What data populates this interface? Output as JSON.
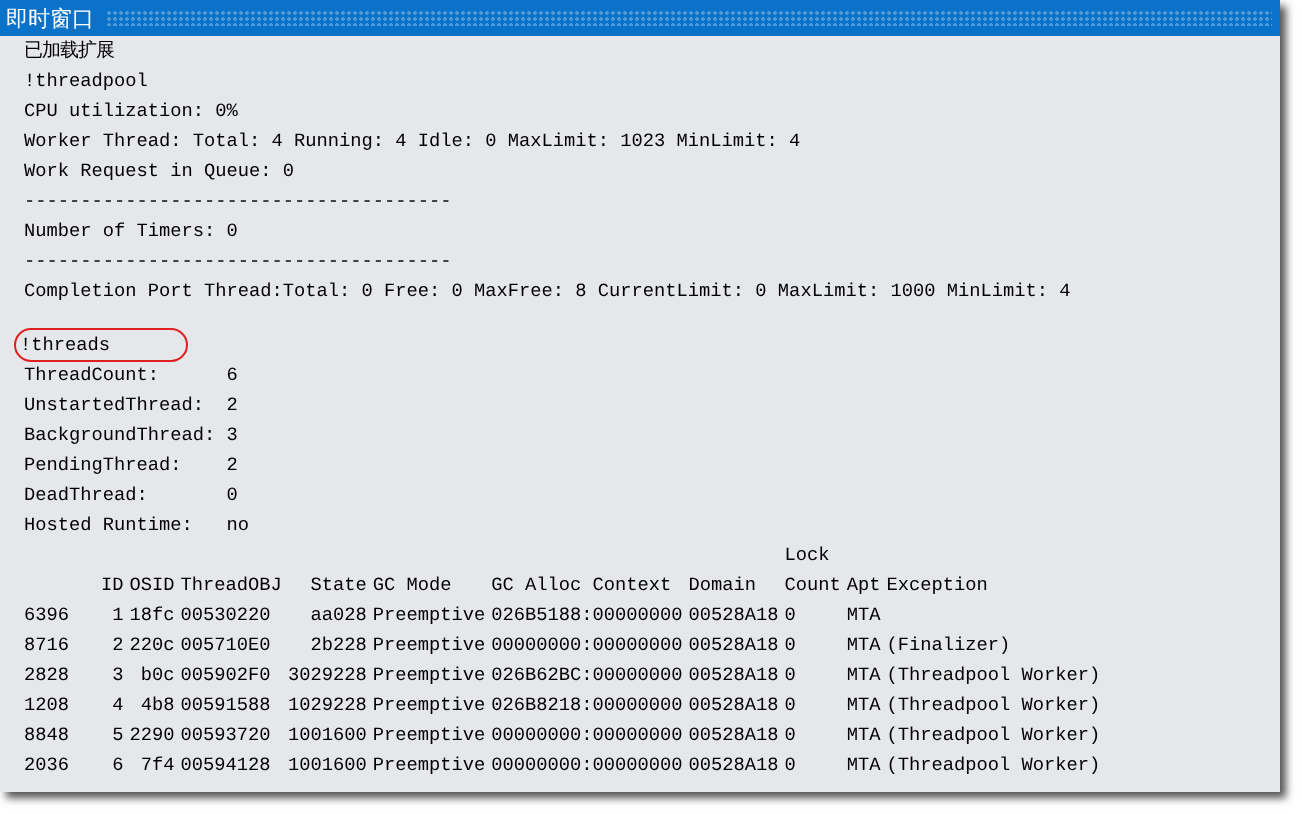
{
  "window": {
    "title": "即时窗口"
  },
  "header_line": "已加载扩展",
  "sections": [
    {
      "command": "!threadpool",
      "circled": false,
      "lines": [
        "CPU utilization: 0%",
        "Worker Thread: Total: 4 Running: 4 Idle: 0 MaxLimit: 1023 MinLimit: 4",
        "Work Request in Queue: 0",
        "--------------------------------------",
        "Number of Timers: 0",
        "--------------------------------------",
        "Completion Port Thread:Total: 0 Free: 0 MaxFree: 8 CurrentLimit: 0 MaxLimit: 1000 MinLimit: 4"
      ]
    },
    {
      "command": "!threads",
      "circled": true,
      "lines": [
        "ThreadCount:      6",
        "UnstartedThread:  2",
        "BackgroundThread: 3",
        "PendingThread:    2",
        "DeadThread:       0",
        "Hosted Runtime:   no"
      ]
    }
  ],
  "table": {
    "columns": [
      {},
      {
        "lines": [
          "ID"
        ]
      },
      {
        "lines": [
          "OSID"
        ]
      },
      {
        "lines": [
          "ThreadOBJ"
        ]
      },
      {
        "lines": [
          "State"
        ]
      },
      {
        "lines": [
          "GC Mode"
        ]
      },
      {
        "lines": [
          "GC Alloc Context"
        ]
      },
      {
        "lines": [
          "Domain"
        ]
      },
      {
        "lines": [
          "Lock",
          "Count"
        ]
      },
      {
        "lines": [
          "Apt"
        ]
      },
      {
        "lines": [
          "Exception"
        ]
      }
    ],
    "rows": [
      [
        "6396",
        "1",
        "18fc",
        "00530220",
        "aa028",
        "Preemptive",
        "026B5188:00000000",
        "00528A18",
        "0",
        "MTA"
      ],
      [
        "8716",
        "2",
        "220c",
        "005710E0",
        "2b228",
        "Preemptive",
        "00000000:00000000",
        "00528A18",
        "0",
        "MTA",
        "(Finalizer)"
      ],
      [
        "2828",
        "3",
        "b0c",
        "005902F0",
        "3029228",
        "Preemptive",
        "026B62BC:00000000",
        "00528A18",
        "0",
        "MTA",
        "(Threadpool Worker)"
      ],
      [
        "1208",
        "4",
        "4b8",
        "00591588",
        "1029228",
        "Preemptive",
        "026B8218:00000000",
        "00528A18",
        "0",
        "MTA",
        "(Threadpool Worker)"
      ],
      [
        "8848",
        "5",
        "2290",
        "00593720",
        "1001600",
        "Preemptive",
        "00000000:00000000",
        "00528A18",
        "0",
        "MTA",
        "(Threadpool Worker)"
      ],
      [
        "2036",
        "6",
        "7f4",
        "00594128",
        "1001600",
        "Preemptive",
        "00000000:00000000",
        "00528A18",
        "0",
        "MTA",
        "(Threadpool Worker)"
      ]
    ]
  }
}
